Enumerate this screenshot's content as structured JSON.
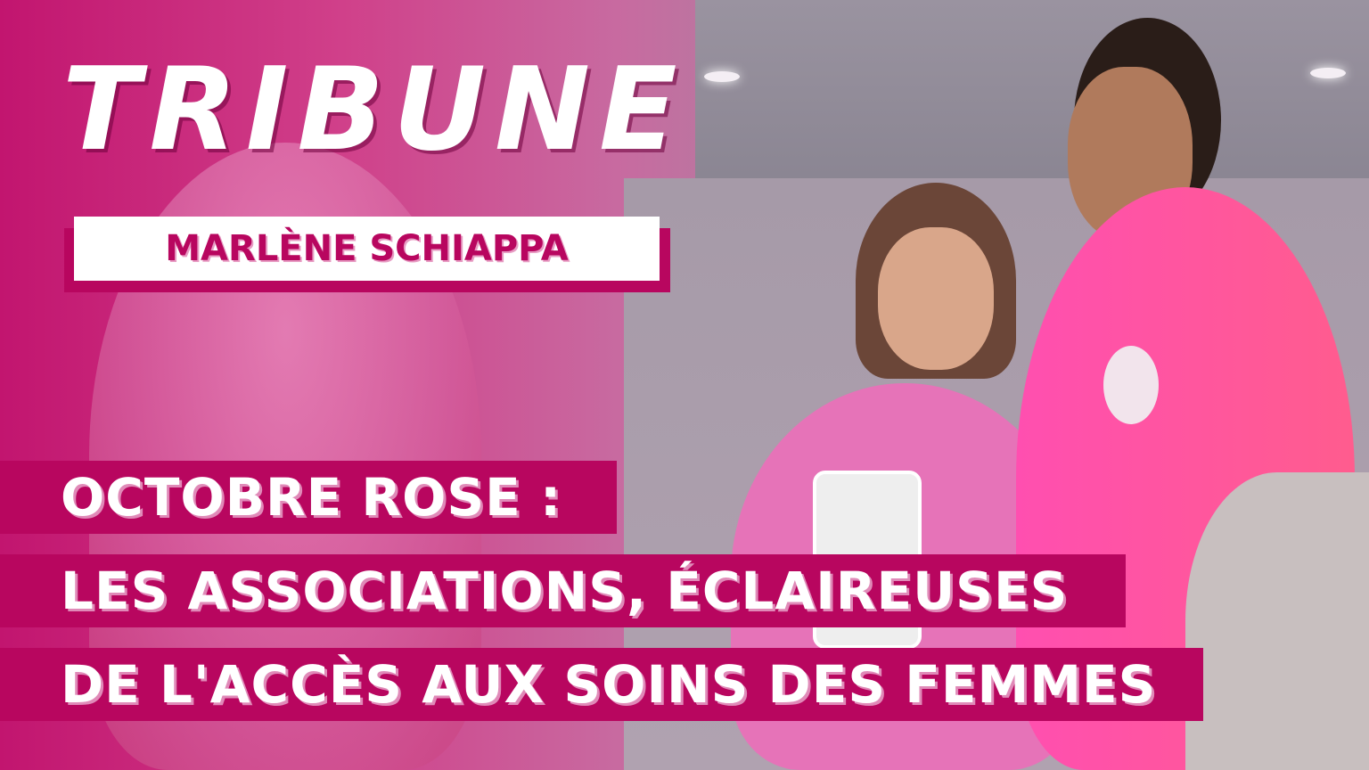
{
  "header": {
    "label": "TRIBUNE",
    "author": "MARLÈNE SCHIAPPA"
  },
  "headline": {
    "lines": [
      "OCTOBRE ROSE :",
      "LES ASSOCIATIONS, ÉCLAIREUSES",
      "DE L'ACCÈS AUX SOINS DES FEMMES"
    ]
  },
  "colors": {
    "brand": "#b8065f",
    "text": "#ffffff"
  }
}
